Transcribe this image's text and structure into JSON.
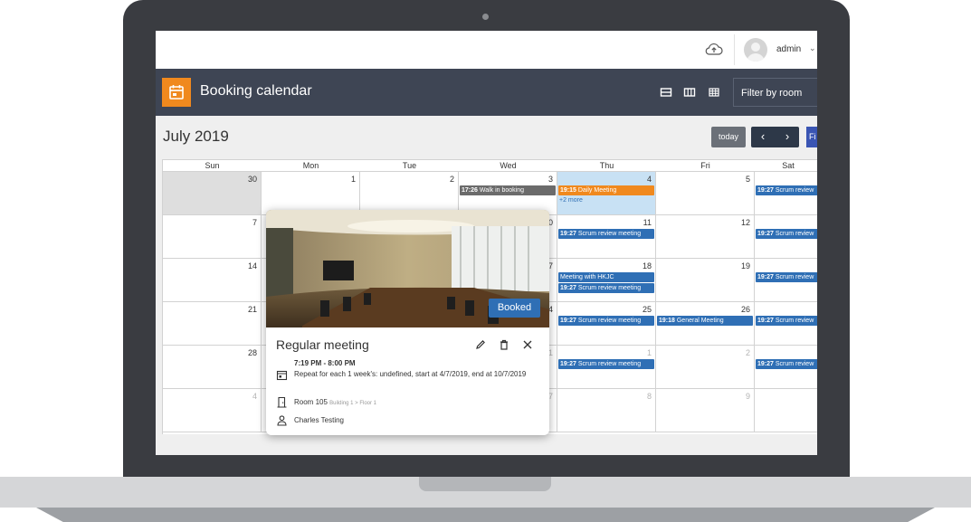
{
  "topbar": {
    "user": "admin",
    "cloud_icon": "cloud-upload-icon",
    "caret_icon": "chevron-down-icon"
  },
  "app": {
    "title": "Booking calendar",
    "icon": "calendar-icon",
    "filter_label": "Filter by room",
    "views": [
      "day-view-icon",
      "week-view-icon",
      "month-view-icon"
    ]
  },
  "calendar": {
    "month_label": "July 2019",
    "today_label": "today",
    "prev_label": "‹",
    "next_label": "›",
    "edge_label": "Fi",
    "days": [
      "Sun",
      "Mon",
      "Tue",
      "Wed",
      "Thu",
      "Fri",
      "Sat"
    ],
    "weeks": [
      [
        "30",
        "1",
        "2",
        "3",
        "4",
        "5",
        ""
      ],
      [
        "7",
        "",
        "",
        "0",
        "11",
        "12",
        ""
      ],
      [
        "14",
        "",
        "",
        "7",
        "18",
        "19",
        ""
      ],
      [
        "21",
        "",
        "",
        "4",
        "25",
        "26",
        ""
      ],
      [
        "28",
        "",
        "",
        "1",
        "1",
        "2",
        ""
      ],
      [
        "4",
        "",
        "",
        "7",
        "8",
        "9",
        ""
      ]
    ],
    "events": {
      "wed3": {
        "time": "17:26",
        "title": "Walk in booking"
      },
      "thu4": {
        "time": "19:15",
        "title": "Daily Meeting"
      },
      "thu4_more": "+2 more",
      "sat6": {
        "time": "19:27",
        "title": "Scrum review"
      },
      "thu11": {
        "time": "19:27",
        "title": "Scrum review meeting"
      },
      "sat13": {
        "time": "19:27",
        "title": "Scrum review"
      },
      "thu18a": {
        "time": "",
        "title": "Meeting with HKJC"
      },
      "thu18b": {
        "time": "19:27",
        "title": "Scrum review meeting"
      },
      "sat20": {
        "time": "19:27",
        "title": "Scrum review"
      },
      "thu25": {
        "time": "19:27",
        "title": "Scrum review meeting"
      },
      "fri26": {
        "time": "19:18",
        "title": "General Meeting"
      },
      "sat27": {
        "time": "19:27",
        "title": "Scrum review"
      },
      "thu1": {
        "time": "19:27",
        "title": "Scrum review meeting"
      },
      "sat3": {
        "time": "19:27",
        "title": "Scrum review"
      }
    },
    "colors": {
      "blue": "#2f6fb5",
      "orange": "#f0891e",
      "gray": "#6b6b6b",
      "today_bg": "#c8e1f4"
    }
  },
  "popup": {
    "status": "Booked",
    "title": "Regular meeting",
    "time": "7:19 PM - 8:00 PM",
    "repeat": "Repeat for each 1 week's: undefined, start at 4/7/2019, end at 10/7/2019",
    "room": "Room 105",
    "location": "Building 1 > Floor 1",
    "person": "Charles Testing",
    "icons": [
      "edit-icon",
      "delete-icon",
      "close-icon",
      "calendar-icon",
      "door-icon",
      "person-icon"
    ]
  }
}
